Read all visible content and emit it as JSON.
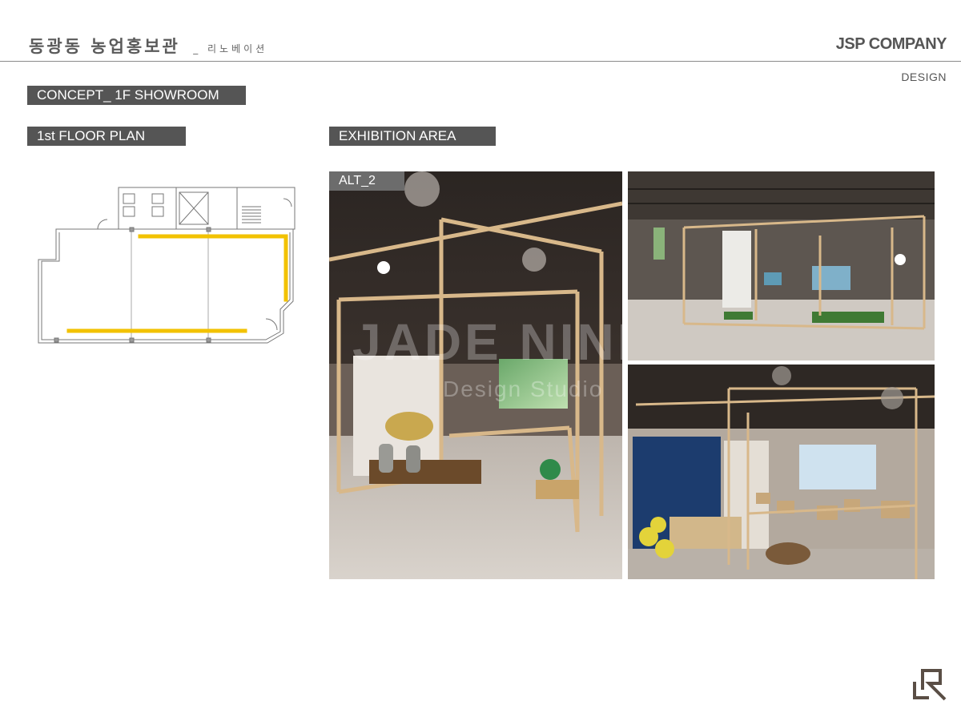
{
  "header": {
    "title": "동광동 농업홍보관",
    "subtitle": "_ 리노베이션",
    "company": "JSP COMPANY",
    "section": "DESIGN"
  },
  "labels": {
    "concept": "CONCEPT_ 1F SHOWROOM",
    "floor_plan": "1st FLOOR PLAN",
    "exhibition": "EXHIBITION AREA",
    "alt": "ALT_2"
  },
  "photo": {
    "watermark": "JADE NINE",
    "watermark_sub": "Design Studio"
  },
  "colors": {
    "header_text": "#5a5a5a",
    "label_bg": "#555555",
    "highlight": "#f2c200",
    "wood": "#d8b88a"
  },
  "icons": [
    "logo-mark-icon"
  ]
}
